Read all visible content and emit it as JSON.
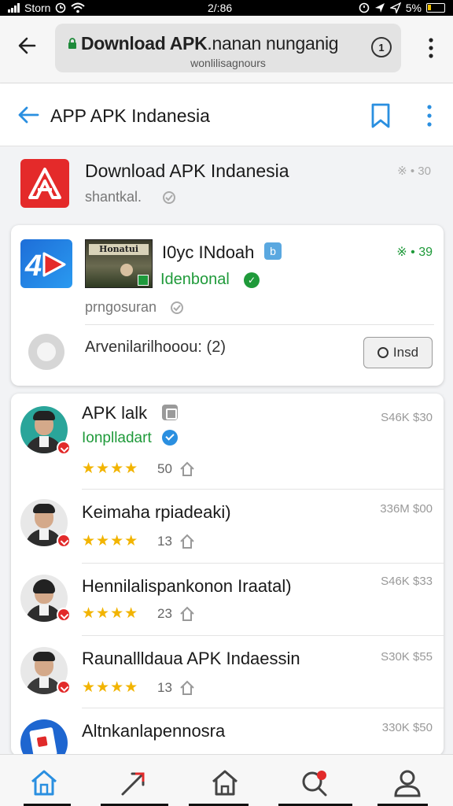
{
  "status_bar": {
    "carrier": "Storn",
    "time": "2/:86",
    "battery": "5%"
  },
  "browser": {
    "url_title": "Download APK",
    "url_title_rest": ".nanan nunganig",
    "url_sub": "wonlilisagnours",
    "info_label": "1"
  },
  "header": {
    "title": "APP APK Indanesia"
  },
  "app_info": {
    "name": "Download APK Indanesia",
    "developer": "shantkal.",
    "meta": "※ • 30"
  },
  "featured": {
    "thumb_text": "Honatui",
    "name": "I0yc INdoah",
    "badge": "b",
    "developer": "Idenbonal",
    "meta": "※ • 39",
    "subtitle": "prngosuran",
    "footer_text": "Arvenilarilhooou: (2)",
    "install_label": "Insd"
  },
  "list": [
    {
      "name": "APK lalk",
      "developer": "Ionplladart",
      "stars": "★★★★",
      "count": "50",
      "meta": "S46K $30",
      "avatar": "teal"
    },
    {
      "name": "Keimaha rpiadeaki)",
      "stars": "★★★★",
      "count": "13",
      "meta": "336M $00",
      "avatar": "light"
    },
    {
      "name": "Hennilalispankonon Iraatal)",
      "stars": "★★★★",
      "count": "23",
      "meta": "S46K $33",
      "avatar": "light"
    },
    {
      "name": "Raunallldaua APK Indaessin",
      "stars": "★★★★",
      "count": "13",
      "meta": "S30K $55",
      "avatar": "light"
    },
    {
      "name": "Altnkanlapennosra",
      "meta": "330K $50",
      "avatar": "blue"
    }
  ],
  "colors": {
    "accent": "#2a8fe0",
    "brand_red": "#e42a2a",
    "green": "#1f9a3a",
    "star": "#f2b400"
  },
  "bottom_nav": [
    "home-icon",
    "trending-icon",
    "store-icon",
    "search-icon",
    "profile-icon"
  ]
}
